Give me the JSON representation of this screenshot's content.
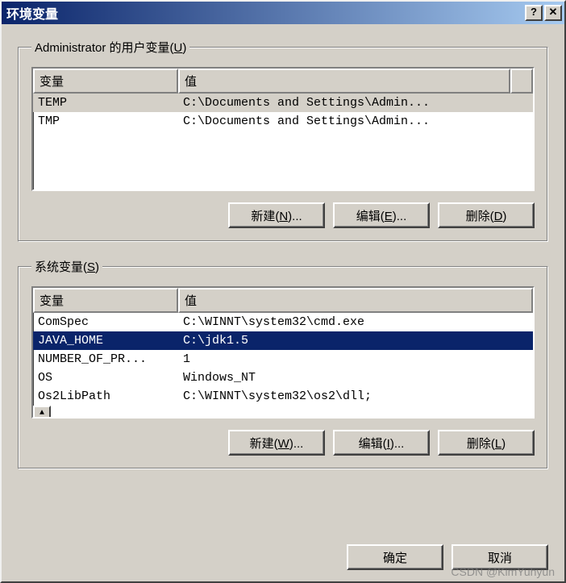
{
  "title": "环境变量",
  "userVars": {
    "legend_prefix": "Administrator 的用户变量(",
    "legend_key": "U",
    "legend_suffix": ")",
    "headers": {
      "name": "变量",
      "value": "值"
    },
    "rows": [
      {
        "name": "TEMP",
        "value": "C:\\Documents and Settings\\Admin..."
      },
      {
        "name": "TMP",
        "value": "C:\\Documents and Settings\\Admin..."
      }
    ],
    "buttons": {
      "new_label": "新建(",
      "new_key": "N",
      "new_suffix": ")...",
      "edit_label": "编辑(",
      "edit_key": "E",
      "edit_suffix": ")...",
      "del_label": "删除(",
      "del_key": "D",
      "del_suffix": ")"
    }
  },
  "sysVars": {
    "legend_prefix": "系统变量(",
    "legend_key": "S",
    "legend_suffix": ")",
    "headers": {
      "name": "变量",
      "value": "值"
    },
    "rows": [
      {
        "name": "ComSpec",
        "value": "C:\\WINNT\\system32\\cmd.exe"
      },
      {
        "name": "JAVA_HOME",
        "value": "C:\\jdk1.5"
      },
      {
        "name": "NUMBER_OF_PR...",
        "value": "1"
      },
      {
        "name": "OS",
        "value": "Windows_NT"
      },
      {
        "name": "Os2LibPath",
        "value": "C:\\WINNT\\system32\\os2\\dll;"
      }
    ],
    "selected_index": 1,
    "buttons": {
      "new_label": "新建(",
      "new_key": "W",
      "new_suffix": ")...",
      "edit_label": "编辑(",
      "edit_key": "I",
      "edit_suffix": ")...",
      "del_label": "删除(",
      "del_key": "L",
      "del_suffix": ")"
    }
  },
  "footer": {
    "ok": "确定",
    "cancel": "取消"
  },
  "watermark": "CSDN @KimYuhyun"
}
